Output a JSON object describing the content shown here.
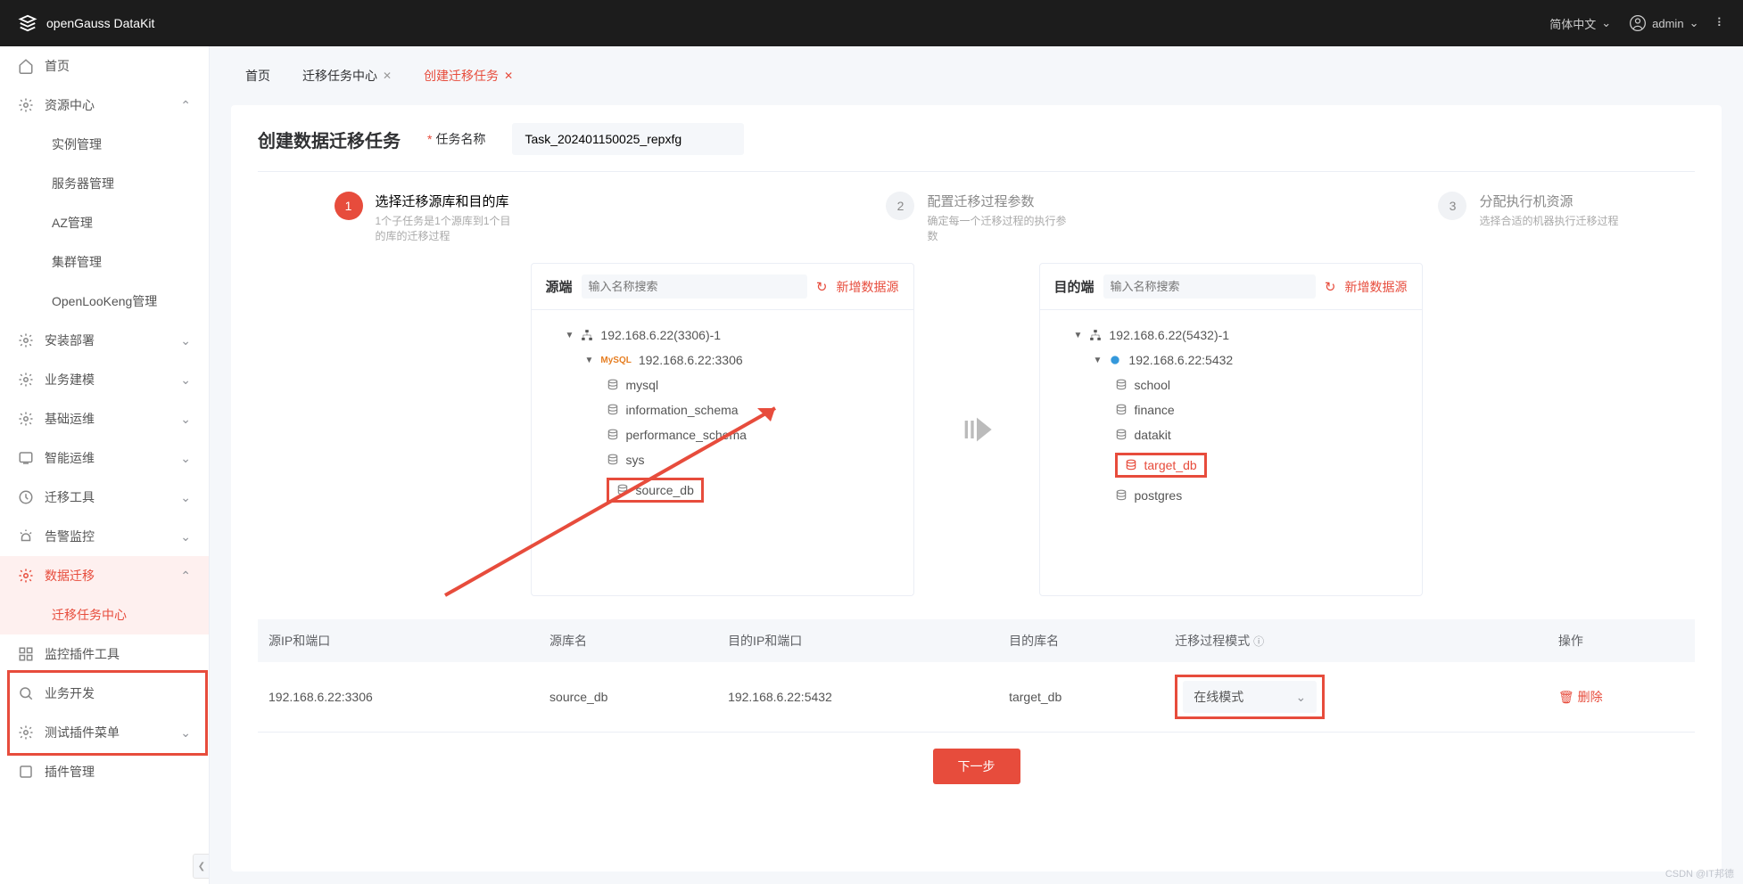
{
  "brand": "openGauss DataKit",
  "topbar": {
    "lang": "简体中文",
    "user": "admin"
  },
  "sidebar": [
    {
      "name": "home",
      "label": "首页",
      "type": "item"
    },
    {
      "name": "resources",
      "label": "资源中心",
      "type": "group",
      "open": true,
      "children": [
        {
          "name": "instance",
          "label": "实例管理"
        },
        {
          "name": "server",
          "label": "服务器管理"
        },
        {
          "name": "az",
          "label": "AZ管理"
        },
        {
          "name": "cluster",
          "label": "集群管理"
        },
        {
          "name": "openlookeng",
          "label": "OpenLooKeng管理"
        }
      ]
    },
    {
      "name": "deploy",
      "label": "安装部署",
      "type": "group"
    },
    {
      "name": "biz-model",
      "label": "业务建模",
      "type": "group"
    },
    {
      "name": "base-ops",
      "label": "基础运维",
      "type": "group"
    },
    {
      "name": "smart-ops",
      "label": "智能运维",
      "type": "group"
    },
    {
      "name": "migrate-tools",
      "label": "迁移工具",
      "type": "group"
    },
    {
      "name": "alarm",
      "label": "告警监控",
      "type": "group"
    },
    {
      "name": "data-migrate",
      "label": "数据迁移",
      "type": "group",
      "open": true,
      "active": true,
      "children": [
        {
          "name": "migrate-task-center",
          "label": "迁移任务中心",
          "active": true
        }
      ]
    },
    {
      "name": "monitor-plugin",
      "label": "监控插件工具",
      "type": "item"
    },
    {
      "name": "biz-dev",
      "label": "业务开发",
      "type": "item"
    },
    {
      "name": "test-plugin",
      "label": "测试插件菜单",
      "type": "group"
    },
    {
      "name": "plugin-mgmt",
      "label": "插件管理",
      "type": "item"
    }
  ],
  "tabs": [
    {
      "name": "home-tab",
      "label": "首页"
    },
    {
      "name": "task-center-tab",
      "label": "迁移任务中心",
      "closable": true
    },
    {
      "name": "create-task-tab",
      "label": "创建迁移任务",
      "closable": true,
      "active": true
    }
  ],
  "page": {
    "title": "创建数据迁移任务",
    "task_name_label": "任务名称",
    "task_name_value": "Task_202401150025_repxfg"
  },
  "steps": [
    {
      "num": "1",
      "title": "选择迁移源库和目的库",
      "desc": "1个子任务是1个源库到1个目的库的迁移过程",
      "active": true
    },
    {
      "num": "2",
      "title": "配置迁移过程参数",
      "desc": "确定每一个迁移过程的执行参数"
    },
    {
      "num": "3",
      "title": "分配执行机资源",
      "desc": "选择合适的机器执行迁移过程"
    }
  ],
  "panels": {
    "search_placeholder": "输入名称搜索",
    "add_source_label": "新增数据源",
    "source": {
      "title": "源端",
      "host": "192.168.6.22(3306)-1",
      "conn": "192.168.6.22:3306",
      "dbs": [
        "mysql",
        "information_schema",
        "performance_schema",
        "sys",
        "source_db"
      ]
    },
    "target": {
      "title": "目的端",
      "host": "192.168.6.22(5432)-1",
      "conn": "192.168.6.22:5432",
      "dbs": [
        "school",
        "finance",
        "datakit",
        "target_db",
        "postgres"
      ]
    }
  },
  "table": {
    "columns": {
      "src_ip": "源IP和端口",
      "src_db": "源库名",
      "dst_ip": "目的IP和端口",
      "dst_db": "目的库名",
      "mode": "迁移过程模式",
      "ops": "操作"
    },
    "row": {
      "src_ip": "192.168.6.22:3306",
      "src_db": "source_db",
      "dst_ip": "192.168.6.22:5432",
      "dst_db": "target_db",
      "mode": "在线模式",
      "delete": "删除"
    }
  },
  "footer": {
    "next": "下一步"
  },
  "watermark": "CSDN @IT邦德"
}
